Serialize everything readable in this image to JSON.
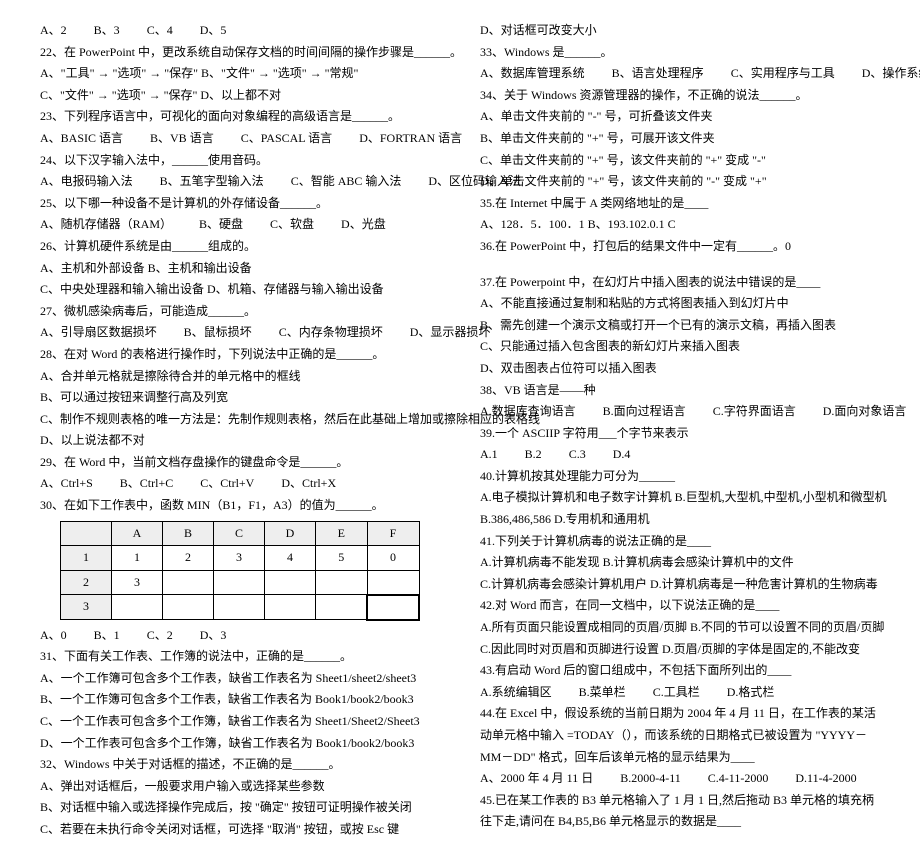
{
  "left": {
    "q21opts": [
      "A、2",
      "B、3",
      "C、4",
      "D、5"
    ],
    "q22": "22、在 PowerPoint 中，更改系统自动保存文档的时间间隔的操作步骤是______。",
    "q22a": "A、\"工具\" → \"选项\" → \"保存\"        B、\"文件\" → \"选项\" → \"常规\"",
    "q22b": "C、\"文件\" → \"选项\" → \"保存\"        D、以上都不对",
    "q23": "23、下列程序语言中，可视化的面向对象编程的高级语言是______。",
    "q23opts": [
      "A、BASIC 语言",
      "B、VB 语言",
      "C、PASCAL 语言",
      "D、FORTRAN 语言"
    ],
    "q24": "24、以下汉字输入法中，______使用音码。",
    "q24opts": [
      "A、电报码输入法",
      "B、五笔字型输入法",
      "C、智能 ABC 输入法",
      "D、区位码输入法"
    ],
    "q25": "25、以下哪一种设备不是计算机的外存储设备______。",
    "q25opts": [
      "A、随机存储器（RAM）",
      "B、硬盘",
      "C、软盘",
      "D、光盘"
    ],
    "q26": "26、计算机硬件系统是由______组成的。",
    "q26a": "A、主机和外部设备                    B、主机和输出设备",
    "q26b": "C、中央处理器和输入输出设备          D、机箱、存储器与输入输出设备",
    "q27": "27、微机感染病毒后，可能造成______。",
    "q27opts": [
      "A、引导扇区数据损坏",
      "B、鼠标损坏",
      "C、内存条物理损坏",
      "D、显示器损坏"
    ],
    "q28": "28、在对 Word 的表格进行操作时，下列说法中正确的是______。",
    "q28a": "A、合并单元格就是擦除待合并的单元格中的框线",
    "q28b": "B、可以通过按钮来调整行高及列宽",
    "q28c": "C、制作不规则表格的唯一方法是：先制作规则表格，然后在此基础上增加或擦除相应的表格线",
    "q28d": "D、以上说法都不对",
    "q29": "29、在 Word 中，当前文档存盘操作的键盘命令是______。",
    "q29opts": [
      "A、Ctrl+S",
      "B、Ctrl+C",
      "C、Ctrl+V",
      "D、Ctrl+X"
    ],
    "q30": "30、在如下工作表中，函数 MIN（B1，F1，A3）的值为______。",
    "q30opts": [
      "A、0",
      "B、1",
      "C、2",
      "D、3"
    ],
    "q31": "31、下面有关工作表、工作簿的说法中，正确的是______。",
    "q31a": "A、一个工作簿可包含多个工作表，缺省工作表名为 Sheet1/sheet2/sheet3",
    "q31b": "B、一个工作簿可包含多个工作表，缺省工作表名为 Book1/book2/book3",
    "q31c": "C、一个工作表可包含多个工作簿，缺省工作表名为 Sheet1/Sheet2/Sheet3",
    "q31d": "D、一个工作表可包含多个工作簿，缺省工作表名为 Book1/book2/book3",
    "q32": "32、Windows 中关于对话框的描述，不正确的是______。",
    "q32a": "A、弹出对话框后，一般要求用户输入或选择某些参数",
    "q32b": "B、对话框中输入或选择操作完成后，按 \"确定\" 按钮可证明操作被关闭",
    "q32c": "C、若要在未执行命令关闭对话框，可选择 \"取消\" 按钮，或按 Esc 键"
  },
  "right": {
    "q32d": "D、对话框可改变大小",
    "q33": "33、Windows 是______。",
    "q33opts": [
      "A、数据库管理系统",
      "B、语言处理程序",
      "C、实用程序与工具",
      "D、操作系统"
    ],
    "q34": "34、关于 Windows 资源管理器的操作，不正确的说法______。",
    "q34a": "A、单击文件夹前的 \"-\" 号，可折叠该文件夹",
    "q34b": "B、单击文件夹前的 \"+\" 号，可展开该文件夹",
    "q34c": "C、单击文件夹前的 \"+\" 号，该文件夹前的 \"+\" 变成 \"-\"",
    "q34d": "D、单击文件夹前的 \"+\" 号，该文件夹前的 \"-\" 变成 \"+\"",
    "q35": "35.在 Internet 中属于 A 类网络地址的是____",
    "q35a": "    A、128．5．100．1    B、193.102.0.1    C",
    "q36": "36.在 PowerPoint 中，打包后的结果文件中一定有______。0",
    "q37": "37.在 Powerpoint 中，在幻灯片中插入图表的说法中错误的是____",
    "q37a": "A、不能直接通过复制和粘贴的方式将图表插入到幻灯片中",
    "q37b": "B、需先创建一个演示文稿或打开一个已有的演示文稿，再插入图表",
    "q37c": "C、只能通过插入包含图表的新幻灯片来插入图表",
    "q37d": "D、双击图表占位符可以插入图表",
    "q38": "38、VB 语言是——种",
    "q38opts": [
      "A.数据库查询语言",
      "B.面向过程语言",
      "C.字符界面语言",
      "D.面向对象语言"
    ],
    "q39": "39.一个 ASCIIP 字符用___个字节来表示",
    "q39opts": [
      "A.1",
      "B.2",
      "C.3",
      "D.4"
    ],
    "q40": "40.计算机按其处理能力可分为______",
    "q40a": "A.电子模拟计算机和电子数字计算机     B.巨型机,大型机,中型机,小型机和微型机",
    "q40b": "B.386,486,586                       D.专用机和通用机",
    "q41": "41.下列关于计算机病毒的说法正确的是____",
    "q41a": "A.计算机病毒不能发现              B.计算机病毒会感染计算机中的文件",
    "q41b": "C.计算机病毒会感染计算机用户      D.计算机病毒是一种危害计算机的生物病毒",
    "q42": "42.对 Word 而言，在同一文档中，以下说法正确的是____",
    "q42a": "A.所有页面只能设置成相同的页眉/页脚   B.不同的节可以设置不同的页眉/页脚",
    "q42b": "C.因此同时对页眉和页脚进行设置        D.页眉/页脚的字体是固定的,不能改变",
    "q43": "43.有启动 Word 后的窗口组成中，不包括下面所列出的____",
    "q43opts": [
      "A.系统编辑区",
      "B.菜单栏",
      "C.工具栏",
      "D.格式栏"
    ],
    "q44": "44.在 Excel 中，假设系统的当前日期为 2004 年 4 月 11 日，在工作表的某活动单元格中输入 =TODAY（），而该系统的日期格式已被设置为 \"YYYY－MM－DD\" 格式，回车后该单元格的显示结果为____",
    "q44opts": [
      "A、2000 年 4 月 11 日",
      "B.2000-4-11",
      "C.4-11-2000",
      "D.11-4-2000"
    ],
    "q45": "45.已在某工作表的 B3 单元格输入了 1 月 1 日,然后拖动 B3 单元格的填充柄往下走,请问在 B4,B5,B6 单元格显示的数据是____"
  },
  "sheet": {
    "headers": [
      "",
      "A",
      "B",
      "C",
      "D",
      "E",
      "F"
    ],
    "rows": [
      [
        "1",
        "1",
        "2",
        "3",
        "4",
        "5",
        "0"
      ],
      [
        "2",
        "3",
        "",
        "",
        "",
        "",
        ""
      ],
      [
        "3",
        "",
        "",
        "",
        "",
        "",
        ""
      ]
    ]
  }
}
